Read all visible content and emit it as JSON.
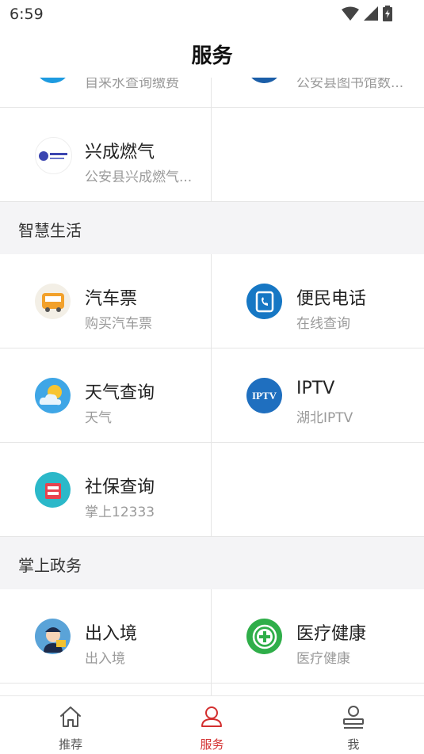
{
  "status_bar": {
    "time": "6:59"
  },
  "header": {
    "title": "服务"
  },
  "partial_top": [
    {
      "title": "",
      "subtitle": "自来水查询缴费",
      "icon": "water-icon"
    },
    {
      "title": "",
      "subtitle": "公安县图书馆数...",
      "icon": "library-icon"
    }
  ],
  "rows_top": [
    {
      "left": {
        "title": "兴成燃气",
        "subtitle": "公安县兴成燃气...",
        "icon": "gas-company-logo-icon"
      }
    }
  ],
  "sections": [
    {
      "title": "智慧生活",
      "items": [
        {
          "title": "汽车票",
          "subtitle": "购买汽车票",
          "icon": "bus-icon"
        },
        {
          "title": "便民电话",
          "subtitle": "在线查询",
          "icon": "phone-book-icon"
        },
        {
          "title": "天气查询",
          "subtitle": "天气",
          "icon": "weather-icon"
        },
        {
          "title": "IPTV",
          "subtitle": "湖北IPTV",
          "icon": "iptv-icon",
          "badge": "IPTV"
        },
        {
          "title": "社保查询",
          "subtitle": "掌上12333",
          "icon": "social-security-icon"
        }
      ]
    },
    {
      "title": "掌上政务",
      "items": [
        {
          "title": "出入境",
          "subtitle": "出入境",
          "icon": "police-avatar-icon"
        },
        {
          "title": "医疗健康",
          "subtitle": "医疗健康",
          "icon": "medical-cross-icon"
        }
      ]
    }
  ],
  "bottom_nav": [
    {
      "label": "推荐",
      "icon": "home-icon",
      "active": false
    },
    {
      "label": "服务",
      "icon": "service-person-icon",
      "active": true
    },
    {
      "label": "我",
      "icon": "profile-icon",
      "active": false
    }
  ],
  "colors": {
    "accent": "#d32f2f",
    "section_bg": "#f4f4f6",
    "divider": "#e5e5e5"
  }
}
